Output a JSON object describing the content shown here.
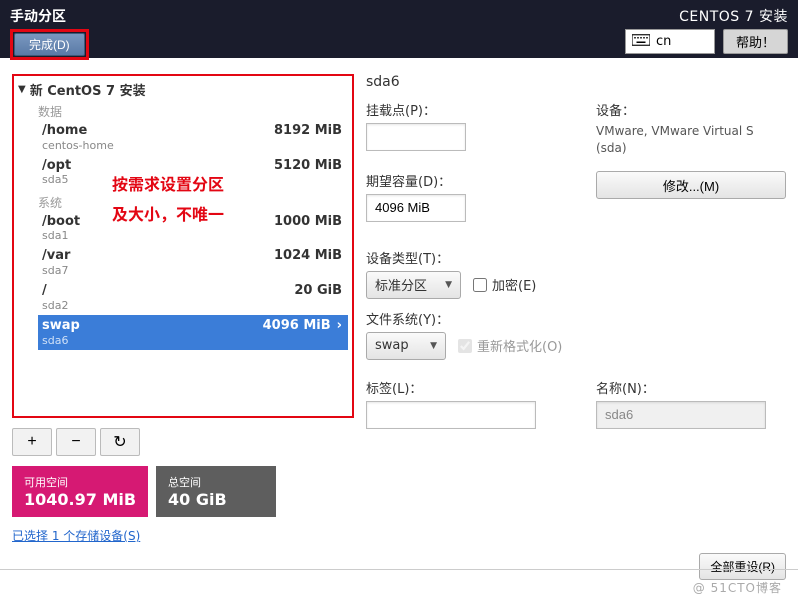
{
  "topbar": {
    "title": "手动分区",
    "done_label": "完成(D)",
    "install_title": "CENTOS 7 安装",
    "lang": "cn",
    "help_label": "帮助！"
  },
  "left": {
    "heading": "新 CentOS 7 安装",
    "sect_data": "数据",
    "sect_system": "系统",
    "partitions": [
      {
        "name": "/home",
        "sub": "centos-home",
        "size": "8192 MiB"
      },
      {
        "name": "/opt",
        "sub": "sda5",
        "size": "5120 MiB"
      },
      {
        "name": "/boot",
        "sub": "sda1",
        "size": "1000 MiB"
      },
      {
        "name": "/var",
        "sub": "sda7",
        "size": "1024 MiB"
      },
      {
        "name": "/",
        "sub": "sda2",
        "size": "20 GiB"
      },
      {
        "name": "swap",
        "sub": "sda6",
        "size": "4096 MiB",
        "selected": true
      }
    ],
    "overlay_line1": "按需求设置分区",
    "overlay_line2": "及大小，不唯一",
    "free": {
      "label": "可用空间",
      "value": "1040.97 MiB"
    },
    "total": {
      "label": "总空间",
      "value": "40 GiB"
    },
    "link": "已选择 1 个存储设备(S)"
  },
  "right": {
    "title": "sda6",
    "mount_label": "挂载点(P)：",
    "device_label": "设备：",
    "device_value": "VMware, VMware Virtual S (sda)",
    "capacity_label": "期望容量(D)：",
    "capacity_value": "4096 MiB",
    "modify_label": "修改...(M)",
    "devtype_label": "设备类型(T)：",
    "devtype_value": "标准分区",
    "encrypt_label": "加密(E)",
    "fs_label": "文件系统(Y)：",
    "fs_value": "swap",
    "reformat_label": "重新格式化(O)",
    "label_label": "标签(L)：",
    "name_label": "名称(N)：",
    "name_value": "sda6",
    "reset_label": "全部重设(R)"
  },
  "watermark": "@ 51CTO博客"
}
